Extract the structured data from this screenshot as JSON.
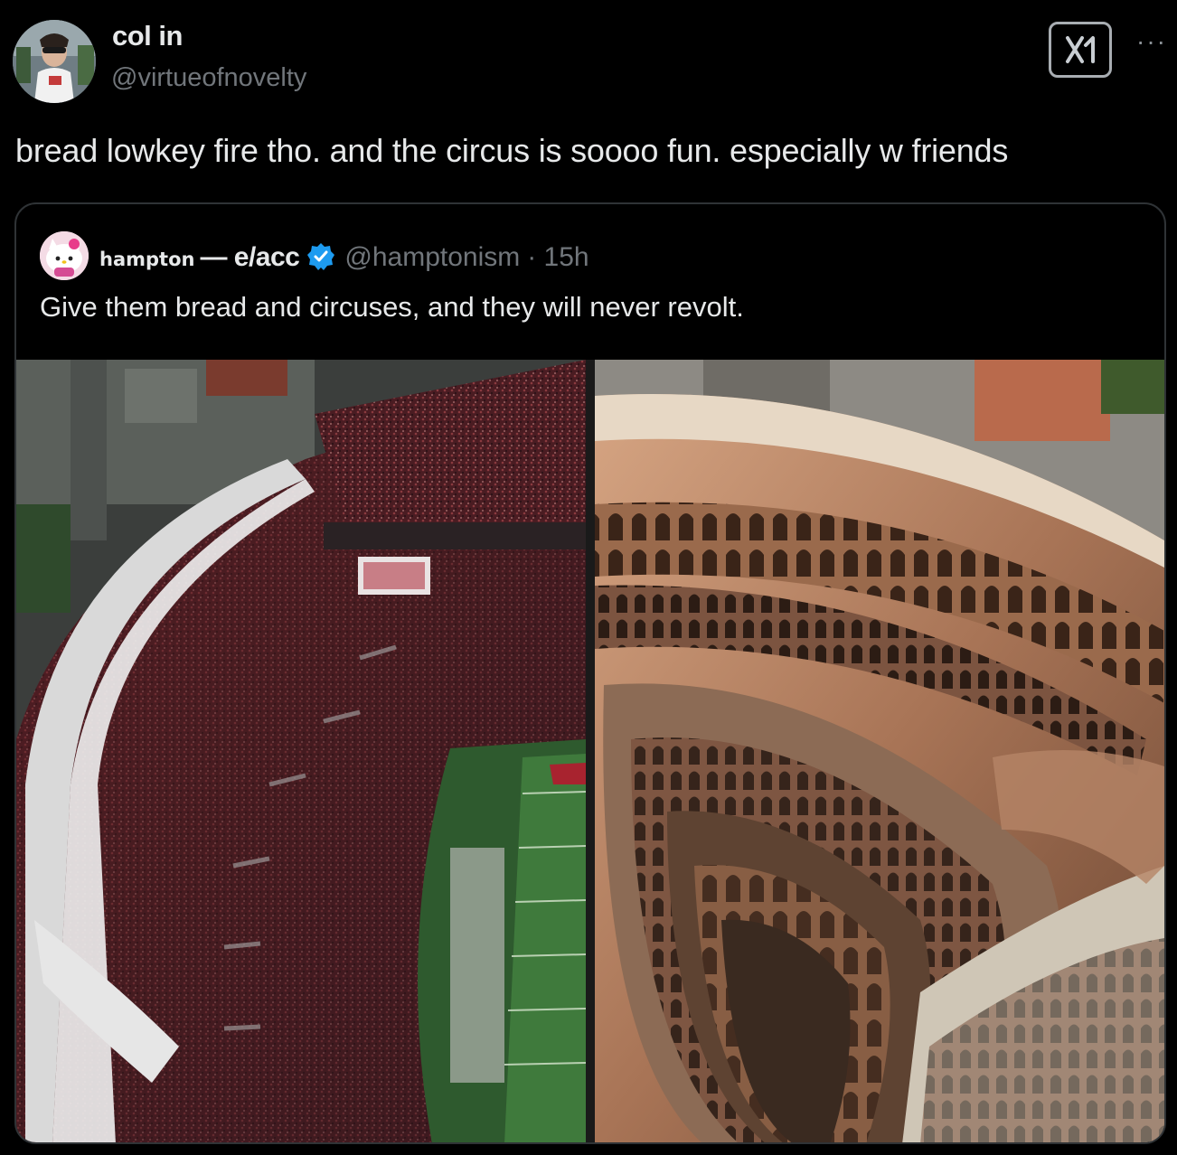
{
  "author": {
    "name": "col in",
    "handle": "@virtueofnovelty",
    "avatar_icon": "profile-photo"
  },
  "actions": {
    "grok_icon": "grok-icon",
    "more_icon": "more-options-icon",
    "more_label": "···"
  },
  "tweet": {
    "text": "bread lowkey fire tho. and the circus is soooo fun. especially w friends"
  },
  "quote": {
    "display_name": "hampton",
    "display_name_suffix": "— e/acc",
    "verified_icon": "verified-badge-icon",
    "verified_color": "#1d9bf0",
    "handle": "@hamptonism",
    "time": "· 15h",
    "text": "Give them bread and circuses, and they will never revolt.",
    "avatar_icon": "hello-kitty-avatar",
    "media": {
      "left_image": "football-stadium-aerial-photo",
      "right_image": "roman-colosseum-aerial-photo"
    }
  }
}
